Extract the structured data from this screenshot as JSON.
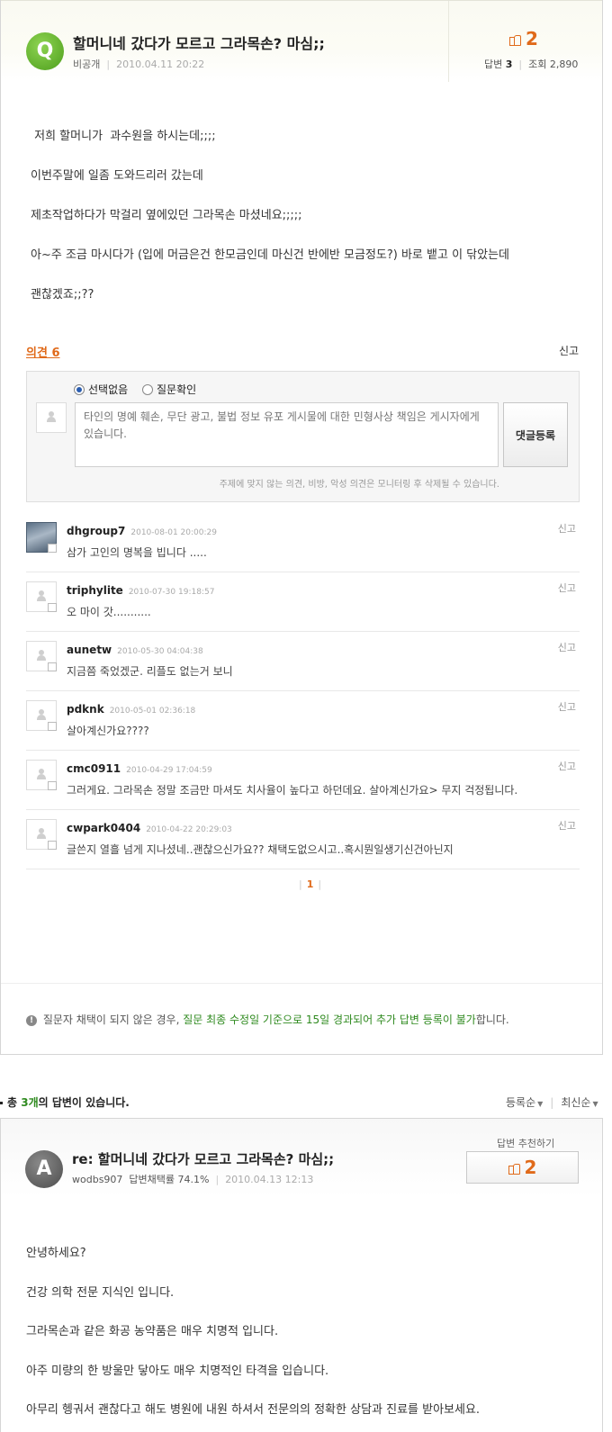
{
  "question": {
    "badge": "Q",
    "title": "할머니네 갔다가 모르고 그라목손? 마심;;",
    "author": "비공개",
    "date": "2010.04.11 20:22",
    "recommend_count": "2",
    "answers_label": "답변",
    "answers_count": "3",
    "views_label": "조회",
    "views_count": "2,890",
    "body": [
      " 저희 할머니가  과수원을 하시는데;;;;",
      "이번주말에 일좀 도와드리러 갔는데",
      "제초작업하다가  막걸리 옆에있던 그라목손 마셨네요;;;;;",
      "아~주 조금 마시다가 (입에 머금은건 한모금인데 마신건 반에반 모금정도?) 바로 뱉고 이 닦았는데",
      "괜찮겠죠;;??"
    ]
  },
  "opinions": {
    "title": "의견 6",
    "report": "신고",
    "form": {
      "radio_none": "선택없음",
      "radio_confirm": "질문확인",
      "placeholder": "타인의 명예 훼손, 무단 광고, 불법 정보 유포 게시물에 대한 민형사상 책임은 게시자에게 있습니다.",
      "submit": "댓글등록",
      "note": "주제에 맞지 않는 의견, 비방, 악성 의견은 모니터링 후 삭제될 수 있습니다."
    },
    "comments": [
      {
        "user": "dhgroup7",
        "date": "2010-08-01 20:00:29",
        "text": "삼가 고인의 명복을 빕니다 .....",
        "report": "신고"
      },
      {
        "user": "triphylite",
        "date": "2010-07-30 19:18:57",
        "text": "오 마이 갓...........",
        "report": "신고"
      },
      {
        "user": "aunetw",
        "date": "2010-05-30 04:04:38",
        "text": "지금쯤 죽었겠군. 리플도 없는거 보니",
        "report": "신고"
      },
      {
        "user": "pdknk",
        "date": "2010-05-01 02:36:18",
        "text": "살아계신가요????",
        "report": "신고"
      },
      {
        "user": "cmc0911",
        "date": "2010-04-29 17:04:59",
        "text": "그러게요. 그라목손 정말 조금만 마셔도 치사율이 높다고 하던데요. 살아계신가요> 무지 걱정됩니다.",
        "report": "신고"
      },
      {
        "user": "cwpark0404",
        "date": "2010-04-22 20:29:03",
        "text": "글쓴지 열흘 넘게 지나셨네..괜찮으신가요?? 채택도없으시고..혹시뭔일생기신건아닌지",
        "report": "신고"
      }
    ],
    "page": "1"
  },
  "notice": {
    "icon": "!",
    "text_before": "질문자 채택이 되지 않은 경우, ",
    "text_highlight": "질문 최종 수정일 기준으로 15일 경과되어 추가 답변 등록이 불가",
    "text_after": "합니다."
  },
  "answers_summary": {
    "prefix": "총 ",
    "count": "3개",
    "suffix": "의 답변이 있습니다.",
    "sort_registered": "등록순",
    "sort_latest": "최신순"
  },
  "answer": {
    "badge": "A",
    "title": "re: 할머니네 갔다가 모르고 그라목손? 마심;;",
    "author": "wodbs907",
    "adopt_rate": "답변채택률 74.1%",
    "date": "2010.04.13 12:13",
    "recommend_label": "답변 추천하기",
    "recommend_count": "2",
    "body": [
      "안녕하세요?",
      "건강 의학 전문 지식인 입니다.",
      "그라목손과 같은 화공 농약품은 매우 치명적 입니다.",
      "아주 미량의 한 방울만 닿아도 매우 치명적인 타격을 입습니다.",
      "아무리 헹궈서 괜찮다고 해도 병원에 내원 하셔서 전문의의 정확한 상담과 진료를 받아보세요."
    ]
  },
  "colors": {
    "accent_orange": "#e06a1a",
    "accent_green": "#2f8a1f",
    "q_badge": "#5aab2a",
    "a_badge": "#555555"
  },
  "icons": [
    "thumbs-up-icon",
    "person-icon",
    "info-icon",
    "sort-arrow-icon"
  ]
}
